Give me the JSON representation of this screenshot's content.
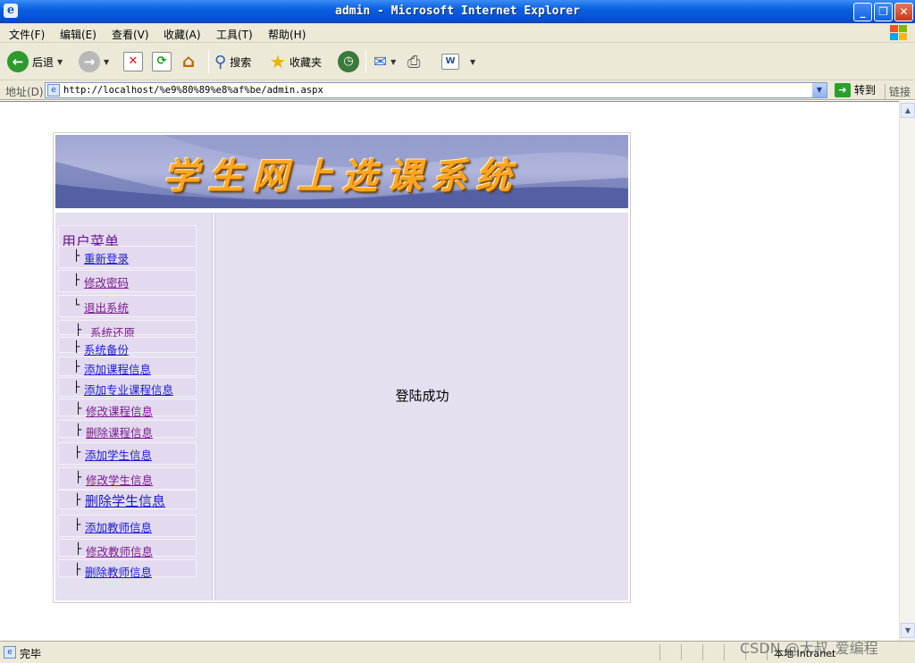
{
  "window": {
    "title": "admin - Microsoft Internet Explorer",
    "minimize": "_",
    "maximize": "❐",
    "close": "✕"
  },
  "menu": [
    "文件(F)",
    "编辑(E)",
    "查看(V)",
    "收藏(A)",
    "工具(T)",
    "帮助(H)"
  ],
  "toolbar": {
    "back_label": "后退",
    "search_label": "搜索",
    "favorites_label": "收藏夹"
  },
  "address": {
    "label": "地址(D)",
    "url": "http://localhost/%e9%80%89%e8%af%be/admin.aspx",
    "go_label": "转到",
    "links_label": "链接"
  },
  "page": {
    "banner_title": "学生网上选课系统",
    "menu_title": "用户菜单",
    "menu_items": [
      {
        "label": "重新登录",
        "branch": "├",
        "color": "blue"
      },
      {
        "label": "修改密码",
        "branch": "├",
        "color": "purple"
      },
      {
        "label": "退出系统",
        "branch": "└",
        "color": "purple"
      },
      {
        "label": "系统还原",
        "branch": "├",
        "color": "purple"
      },
      {
        "label": "系统备份",
        "branch": "├",
        "color": "blue"
      },
      {
        "label": "添加课程信息",
        "branch": "├",
        "color": "blue"
      },
      {
        "label": "添加专业课程信息",
        "branch": "├",
        "color": "blue"
      },
      {
        "label": "修改课程信息",
        "branch": "├",
        "color": "purple"
      },
      {
        "label": "删除课程信息",
        "branch": "├",
        "color": "purple"
      },
      {
        "label": "添加学生信息",
        "branch": "├",
        "color": "blue"
      },
      {
        "label": "修改学生信息",
        "branch": "├",
        "color": "purple"
      },
      {
        "label": "删除学生信息",
        "branch": "├",
        "color": "blue"
      },
      {
        "label": "添加教师信息",
        "branch": "├",
        "color": "blue"
      },
      {
        "label": "修改教师信息",
        "branch": "├",
        "color": "purple"
      },
      {
        "label": "删除教师信息",
        "branch": "├",
        "color": "blue"
      }
    ],
    "main_message": "登陆成功"
  },
  "status": {
    "text": "完毕",
    "zone": "本地 Intranet"
  },
  "watermark": "CSDN @大叔_爱编程",
  "colors": {
    "titlebar": "#0a5fe0",
    "chrome": "#ece9d8",
    "panel": "#e6dff0",
    "banner_text": "#ffa51f"
  }
}
